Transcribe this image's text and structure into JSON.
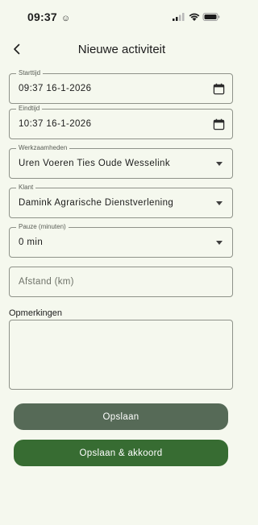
{
  "status_bar": {
    "time": "09:37",
    "smiley": "☺"
  },
  "header": {
    "title": "Nieuwe activiteit"
  },
  "form": {
    "start_time": {
      "label": "Starttijd",
      "value": "09:37 16-1-2026"
    },
    "end_time": {
      "label": "Eindtijd",
      "value": "10:37 16-1-2026"
    },
    "activities": {
      "label": "Werkzaamheden",
      "value": "Uren Voeren Ties Oude Wesselink"
    },
    "client": {
      "label": "Klant",
      "value": "Damink Agrarische Dienstverlening"
    },
    "pause": {
      "label": "Pauze (minuten)",
      "value": "0 min"
    },
    "distance": {
      "placeholder": "Afstand (km)"
    },
    "remarks": {
      "label": "Opmerkingen",
      "value": ""
    }
  },
  "actions": {
    "save_label": "Opslaan",
    "save_approve_label": "Opslaan & akkoord"
  },
  "colors": {
    "background": "#f5f8ee",
    "save_button": "#566a57",
    "save_approve_button": "#376c32",
    "outline": "#8e9289"
  }
}
